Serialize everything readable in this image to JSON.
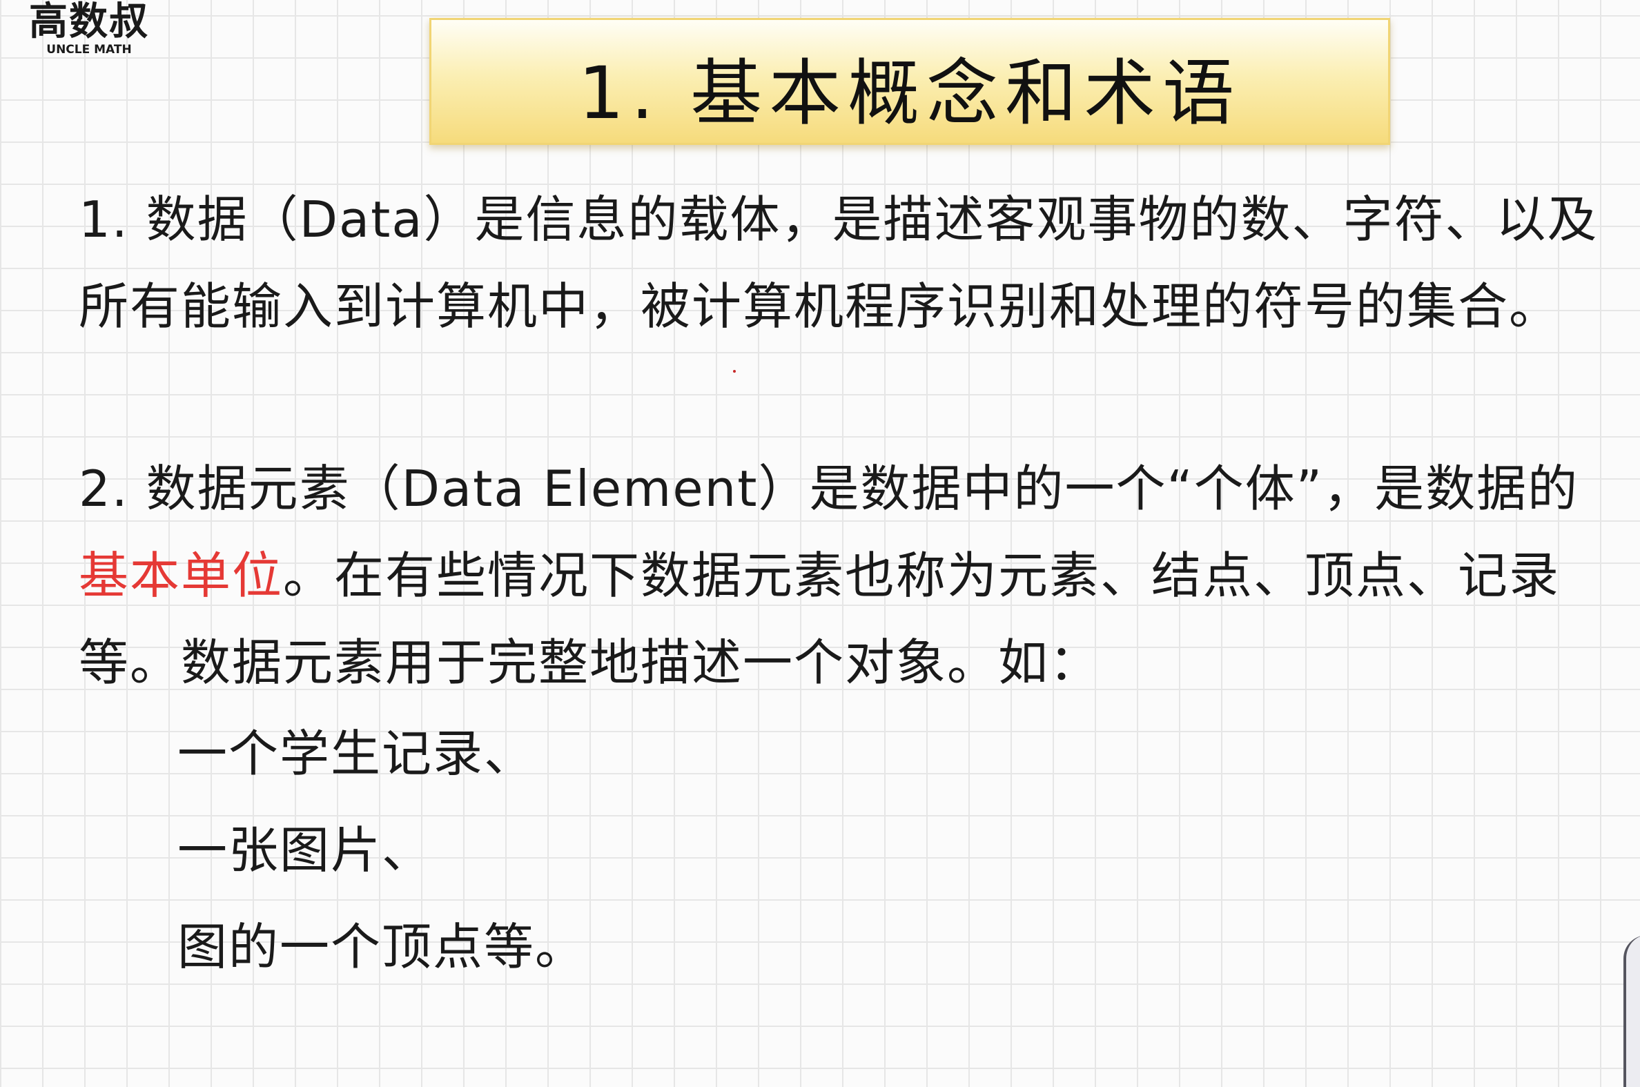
{
  "logo": {
    "name": "高数叔",
    "subtitle": "UNCLE MATH"
  },
  "title": "1. 基本概念和术语",
  "paragraphs": {
    "p1": "1. 数据（Data）是信息的载体，是描述客观事物的数、字符、以及所有能输入到计算机中，被计算机程序识别和处理的符号的集合。",
    "p2": {
      "before": "2. 数据元素（Data Element）是数据中的一个“个体”，是数据的",
      "highlight": "基本单位",
      "after": "。在有些情况下数据元素也称为元素、结点、顶点、记录等。数据元素用于完整地描述一个对象。如："
    }
  },
  "examples": [
    "一个学生记录、",
    "一张图片、",
    "图的一个顶点等。"
  ],
  "colors": {
    "highlight": "#e53935",
    "banner": "#f6db7c"
  }
}
